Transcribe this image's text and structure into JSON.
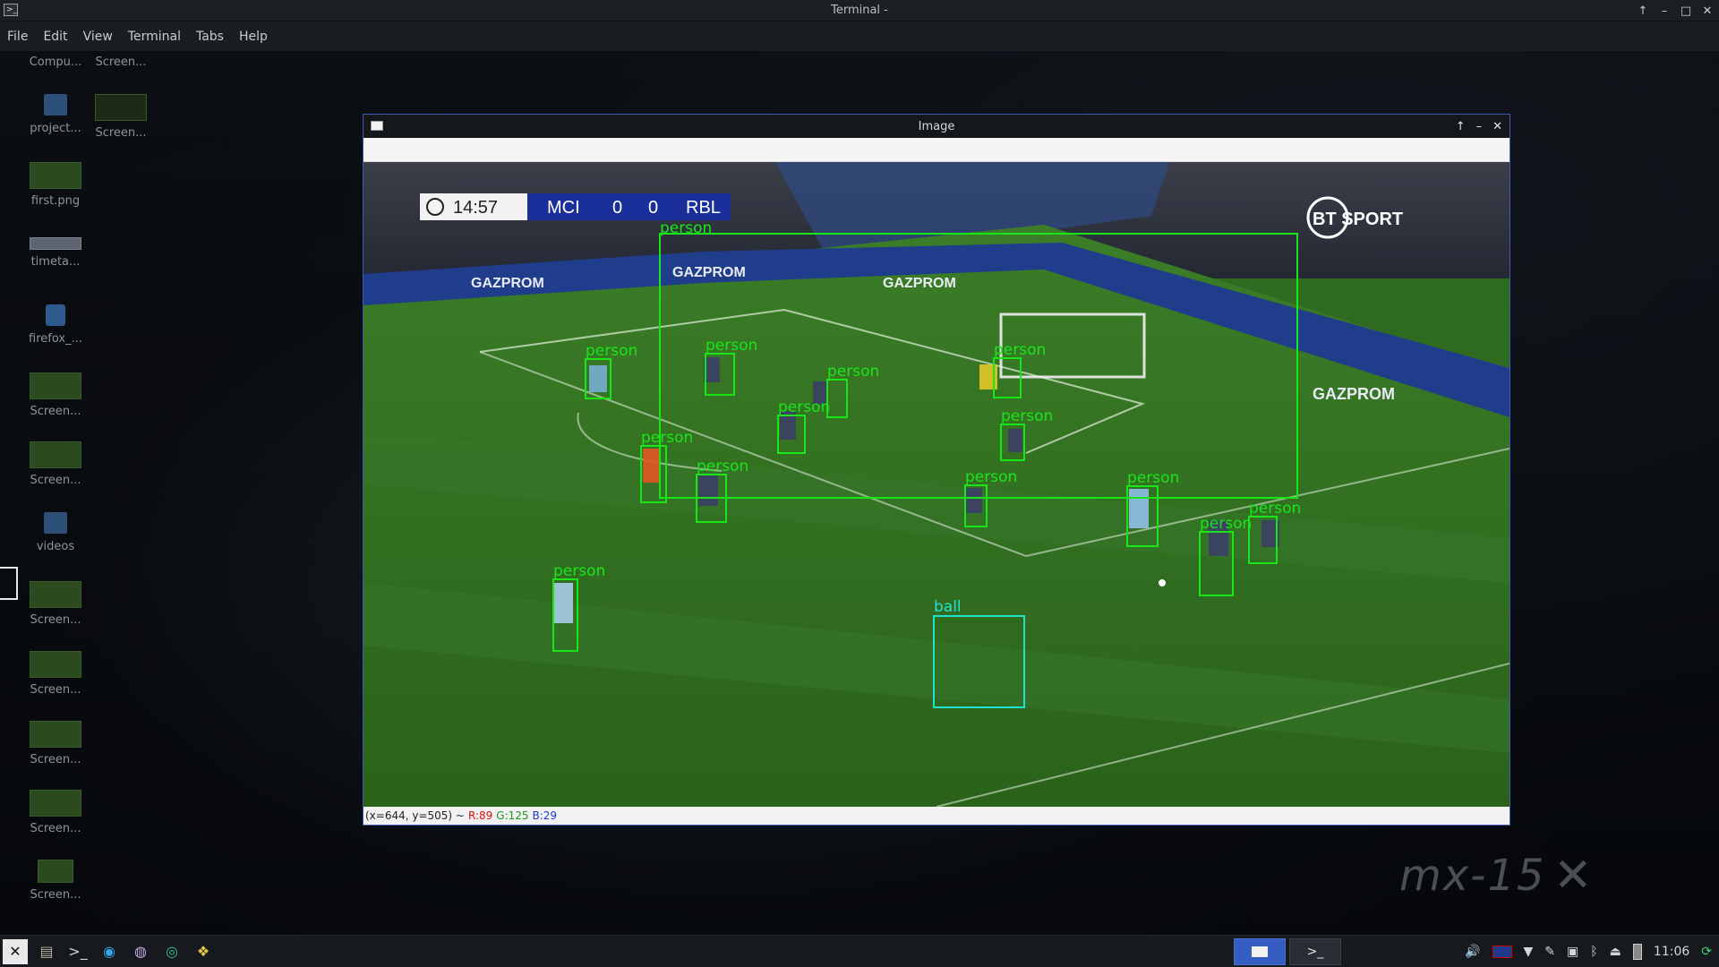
{
  "terminal": {
    "title": "Terminal -",
    "menu": [
      "File",
      "Edit",
      "View",
      "Terminal",
      "Tabs",
      "Help"
    ],
    "controls": [
      "↑",
      "–",
      "□",
      "✕"
    ]
  },
  "desktop_icons": [
    {
      "label": "Compu...",
      "kind": "none"
    },
    {
      "label": "Screen...",
      "kind": "none"
    },
    {
      "label": "project...",
      "kind": "folder"
    },
    {
      "label": "Screen...",
      "kind": "thumb"
    },
    {
      "label": "first.png",
      "kind": "thumb"
    },
    {
      "label": "timeta...",
      "kind": "thumb"
    },
    {
      "label": "firefox_...",
      "kind": "ffx"
    },
    {
      "label": "Screen...",
      "kind": "thumb"
    },
    {
      "label": "Screen...",
      "kind": "thumb"
    },
    {
      "label": "videos",
      "kind": "folder"
    },
    {
      "label": "Screen...",
      "kind": "thumb"
    },
    {
      "label": "Screen...",
      "kind": "thumb"
    },
    {
      "label": "Screen...",
      "kind": "thumb"
    },
    {
      "label": "Screen...",
      "kind": "thumb"
    },
    {
      "label": "Screen...",
      "kind": "thumb"
    }
  ],
  "image_window": {
    "title": "Image",
    "controls": [
      "↑",
      "–",
      "✕"
    ],
    "status": {
      "coords": "(x=644, y=505) ~",
      "r": "R:89",
      "g": "G:125",
      "b": "B:29"
    }
  },
  "scene": {
    "scoreboard": {
      "time": "14:57",
      "home": "MCI",
      "home_score": "0",
      "away_score": "0",
      "away": "RBL"
    },
    "broadcaster": "BT SPORT",
    "sponsor": "GAZPROM",
    "label_person": "person",
    "label_ball": "ball",
    "colors": {
      "person_box": "#19e619",
      "ball_box": "#1fe3d0",
      "pitch": "#2f6d1f"
    }
  },
  "taskbar": {
    "clock": "11:06",
    "apps": [
      "mx-logo-icon",
      "file-manager-icon",
      "terminal-icon",
      "browser-icon",
      "paint-icon",
      "app-icon",
      "python-icon"
    ]
  },
  "watermark": {
    "text": "mx-15"
  }
}
